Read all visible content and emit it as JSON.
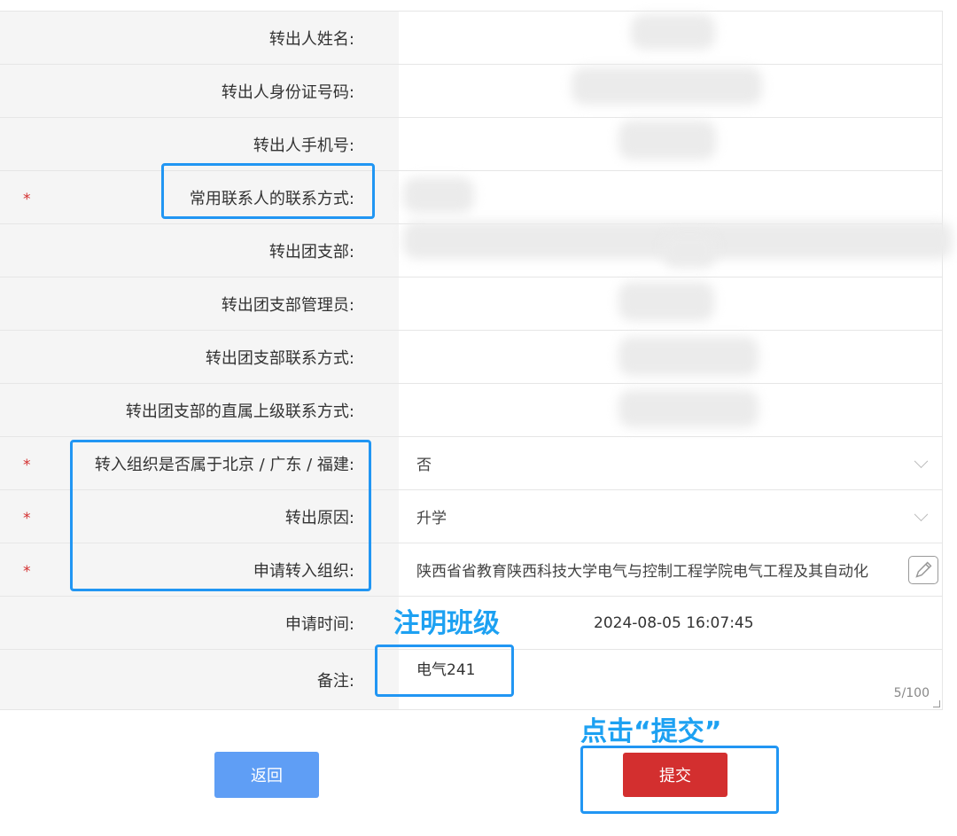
{
  "form": {
    "rows": [
      {
        "label": "转出人姓名:",
        "required": false,
        "value": ""
      },
      {
        "label": "转出人身份证号码:",
        "required": false,
        "value": ""
      },
      {
        "label": "转出人手机号:",
        "required": false,
        "value": ""
      },
      {
        "label": "常用联系人的联系方式:",
        "required": true,
        "value": ""
      },
      {
        "label": "转出团支部:",
        "required": false,
        "value": ""
      },
      {
        "label": "转出团支部管理员:",
        "required": false,
        "value": ""
      },
      {
        "label": "转出团支部联系方式:",
        "required": false,
        "value": ""
      },
      {
        "label": "转出团支部的直属上级联系方式:",
        "required": false,
        "value": ""
      },
      {
        "label": "转入组织是否属于北京 / 广东 / 福建:",
        "required": true,
        "value": "否"
      },
      {
        "label": "转出原因:",
        "required": true,
        "value": "升学"
      },
      {
        "label": "申请转入组织:",
        "required": true,
        "value": "陕西省省教育陕西科技大学电气与控制工程学院电气工程及其自动化"
      },
      {
        "label": "申请时间:",
        "required": false,
        "value": "2024-08-05 16:07:45"
      },
      {
        "label": "备注:",
        "required": false,
        "value": "电气241",
        "counter": "5/100"
      }
    ],
    "required_mark": "*"
  },
  "annotations": {
    "note_hint": "注明班级",
    "submit_hint": "点击“提交”"
  },
  "buttons": {
    "back": "返回",
    "submit": "提交"
  },
  "icons": {
    "select_arrow": "chevron-down-icon",
    "edit": "pencil-icon"
  },
  "colors": {
    "required": "#d32f2f",
    "annotation": "#2196f3",
    "back_button": "#5f9ef5",
    "submit_button": "#d32f2f"
  }
}
